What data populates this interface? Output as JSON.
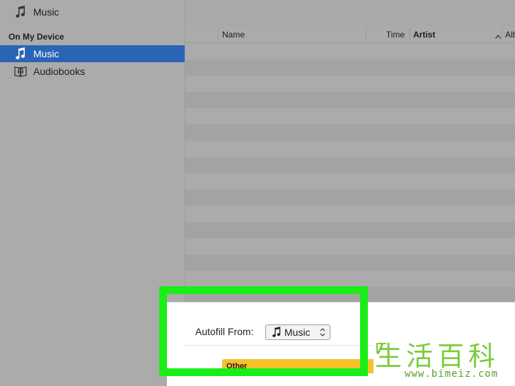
{
  "sidebar": {
    "top_item": {
      "label": "Music",
      "icon": "music-note-icon"
    },
    "section_header": "On My Device",
    "items": [
      {
        "label": "Music",
        "icon": "music-note-icon",
        "selected": true
      },
      {
        "label": "Audiobooks",
        "icon": "audiobook-icon",
        "selected": false
      }
    ]
  },
  "table": {
    "columns": [
      {
        "label": "Name"
      },
      {
        "label": "Time"
      },
      {
        "label": "Artist",
        "sorted": "ascending"
      },
      {
        "label": "Alb"
      }
    ]
  },
  "autofill": {
    "label": "Autofill From:",
    "selected": "Music",
    "icon": "music-note-icon"
  },
  "capacity": {
    "label": "Other",
    "color": "#f5c22a"
  },
  "highlight": {
    "color": "#19ee19"
  },
  "selection_color": "#2a64b7",
  "watermark": {
    "chars": "生活百科",
    "url": "www.bimeiz.com"
  }
}
